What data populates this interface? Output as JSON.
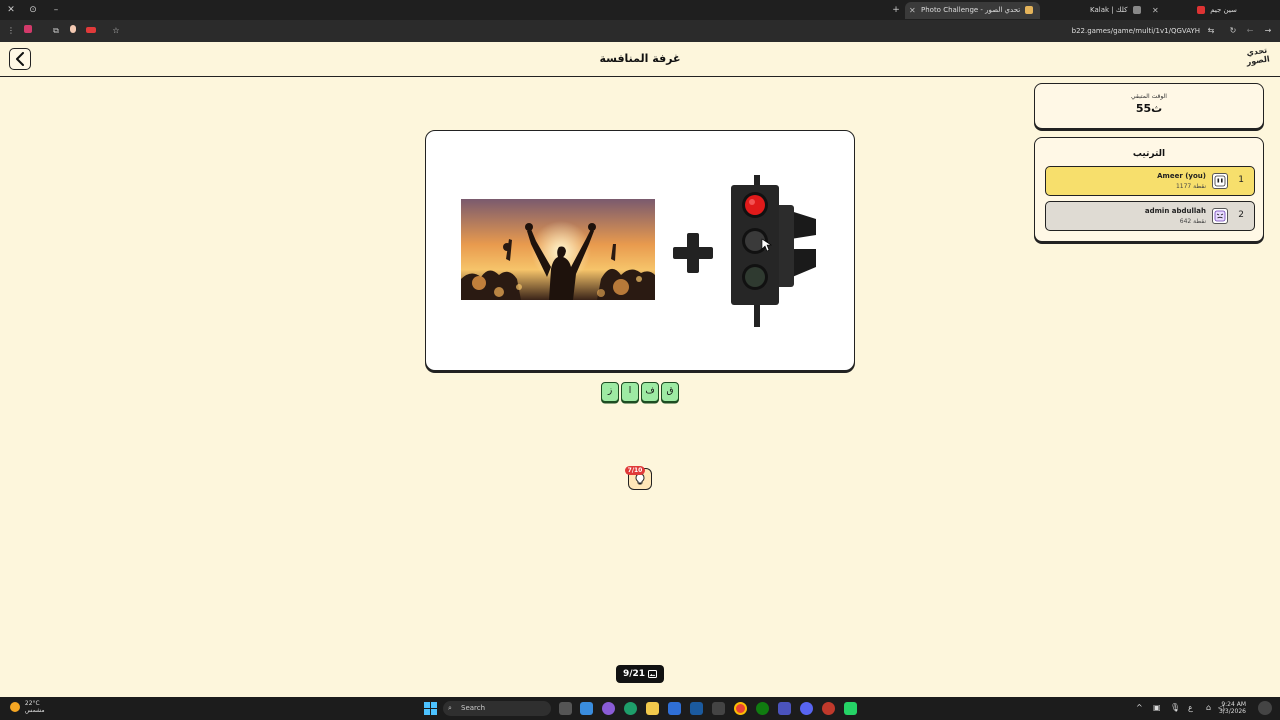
{
  "browser": {
    "tabs": [
      {
        "label": "سين جيم",
        "active": false
      },
      {
        "label": "Kalak | كلك",
        "active": false
      },
      {
        "label": "Photo Challenge - تحدي الصور",
        "active": true
      }
    ],
    "url": "b22.games/game/multi/1v1/QGVAYH"
  },
  "header": {
    "title": "غرفة المنافسة",
    "logo_text": "تحدي الصور"
  },
  "timer": {
    "label": "الوقت المتبقي",
    "value": "55ث"
  },
  "ranking": {
    "title": "الترتيب",
    "players": [
      {
        "rank": "1",
        "name": "Ameer (you)",
        "points": "1177 نقطة"
      },
      {
        "rank": "2",
        "name": "admin abdullah",
        "points": "642 نقطة"
      }
    ]
  },
  "answer": {
    "letters": [
      "ق",
      "ف",
      "ا",
      "ز"
    ]
  },
  "hint": {
    "badge": "7/10"
  },
  "progress": {
    "text": "9/21"
  },
  "taskbar": {
    "weather_temp": "22°C",
    "weather_desc": "مشمس",
    "search_label": "Search",
    "time": "9:24 AM",
    "date": "3/3/2026"
  },
  "colors": {
    "background": "#fdf6dc",
    "rank1": "#f7df6c",
    "rank2": "#dfdbd3",
    "letter_tile": "#9eeaa3",
    "hint_badge": "#e03a3a"
  }
}
